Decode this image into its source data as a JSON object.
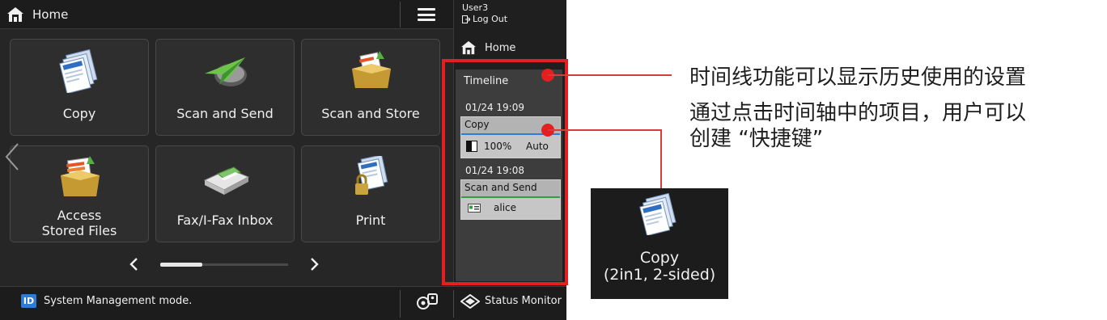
{
  "header": {
    "home_label": "Home"
  },
  "account": {
    "user": "User3",
    "logout_label": "Log Out"
  },
  "side_nav": {
    "home_label": "Home"
  },
  "tiles": [
    {
      "label": "Copy"
    },
    {
      "label": "Scan and Send"
    },
    {
      "label": "Scan and Store"
    },
    {
      "label_line1": "Access",
      "label_line2": "Stored Files"
    },
    {
      "label": "Fax/I-Fax Inbox"
    },
    {
      "label": "Print"
    }
  ],
  "pager": {
    "page_fraction": 0.33
  },
  "timeline": {
    "title": "Timeline",
    "entries": [
      {
        "time": "01/24 19:09",
        "name": "Copy",
        "ratio": "100%",
        "mode": "Auto",
        "accent": "#2f7cd8"
      },
      {
        "time": "01/24 19:08",
        "name": "Scan and Send",
        "user": "alice",
        "accent": "#2e9e3e"
      }
    ]
  },
  "status": {
    "message": "System Management mode.",
    "id_badge": "ID",
    "monitor_label": "Status Monitor"
  },
  "annotations": {
    "line1": "时间线功能可以显示历史使用的设置",
    "line2": "通过点击时间轴中的项目，用户可以",
    "line3": "创建 “快捷键”"
  },
  "shortcut": {
    "line1": "Copy",
    "line2": "(2in1, 2-sided)"
  },
  "colors": {
    "highlight": "#e41f1f",
    "panel_bg": "#262626",
    "id_blue": "#2f7cd8"
  }
}
